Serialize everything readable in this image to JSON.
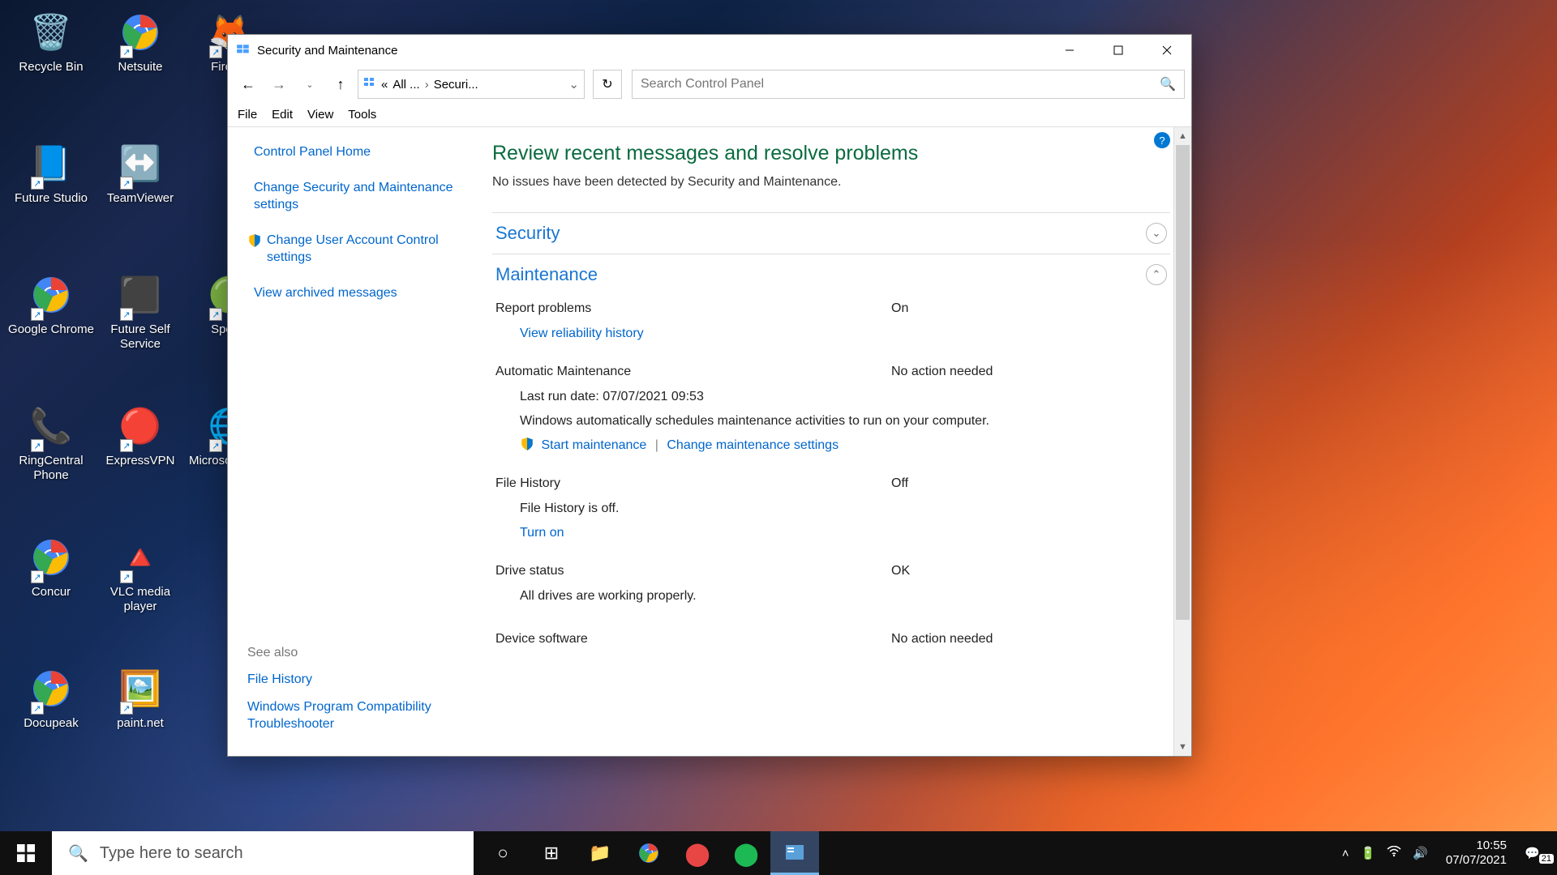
{
  "desktop_icons": [
    {
      "label": "Recycle Bin",
      "glyph": "🗑️"
    },
    {
      "label": "Netsuite",
      "glyph": "chrome"
    },
    {
      "label": "Firefox",
      "glyph": "🦊"
    },
    {
      "label": "Future Studio",
      "glyph": "📘"
    },
    {
      "label": "TeamViewer",
      "glyph": "↔️"
    },
    {
      "label": "",
      "glyph": ""
    },
    {
      "label": "Google Chrome",
      "glyph": "chrome"
    },
    {
      "label": "Future Self Service",
      "glyph": "⬛"
    },
    {
      "label": "Spotify",
      "glyph": "🟢"
    },
    {
      "label": "RingCentral Phone",
      "glyph": "📞"
    },
    {
      "label": "ExpressVPN",
      "glyph": "🔴"
    },
    {
      "label": "Microsoft Edge",
      "glyph": "🌐"
    },
    {
      "label": "Concur",
      "glyph": "chrome"
    },
    {
      "label": "VLC media player",
      "glyph": "🔺"
    },
    {
      "label": "",
      "glyph": ""
    },
    {
      "label": "Docupeak",
      "glyph": "chrome"
    },
    {
      "label": "paint.net",
      "glyph": "🖼️"
    }
  ],
  "window": {
    "title": "Security and Maintenance",
    "breadcrumb": {
      "root": "«",
      "parent": "All ...",
      "current": "Securi..."
    },
    "search_placeholder": "Search Control Panel",
    "menu": [
      "File",
      "Edit",
      "View",
      "Tools"
    ]
  },
  "sidebar": {
    "links": [
      "Control Panel Home",
      "Change Security and Maintenance settings",
      "Change User Account Control settings",
      "View archived messages"
    ],
    "see_also_header": "See also",
    "see_also": [
      "File History",
      "Windows Program Compatibility Troubleshooter"
    ]
  },
  "main": {
    "heading": "Review recent messages and resolve problems",
    "subtext": "No issues have been detected by Security and Maintenance.",
    "sections": {
      "security": {
        "title": "Security"
      },
      "maintenance": {
        "title": "Maintenance",
        "report_problems": {
          "label": "Report problems",
          "status": "On",
          "link": "View reliability history"
        },
        "auto_maint": {
          "label": "Automatic Maintenance",
          "status": "No action needed",
          "last_run": "Last run date: 07/07/2021 09:53",
          "desc": "Windows automatically schedules maintenance activities to run on your computer.",
          "link1": "Start maintenance",
          "link2": "Change maintenance settings"
        },
        "file_history": {
          "label": "File History",
          "status": "Off",
          "desc": "File History is off.",
          "link": "Turn on"
        },
        "drive": {
          "label": "Drive status",
          "status": "OK",
          "desc": "All drives are working properly."
        },
        "device": {
          "label": "Device software",
          "status": "No action needed"
        }
      }
    }
  },
  "taskbar": {
    "search_placeholder": "Type here to search",
    "time": "10:55",
    "date": "07/07/2021",
    "notif_count": "21"
  }
}
